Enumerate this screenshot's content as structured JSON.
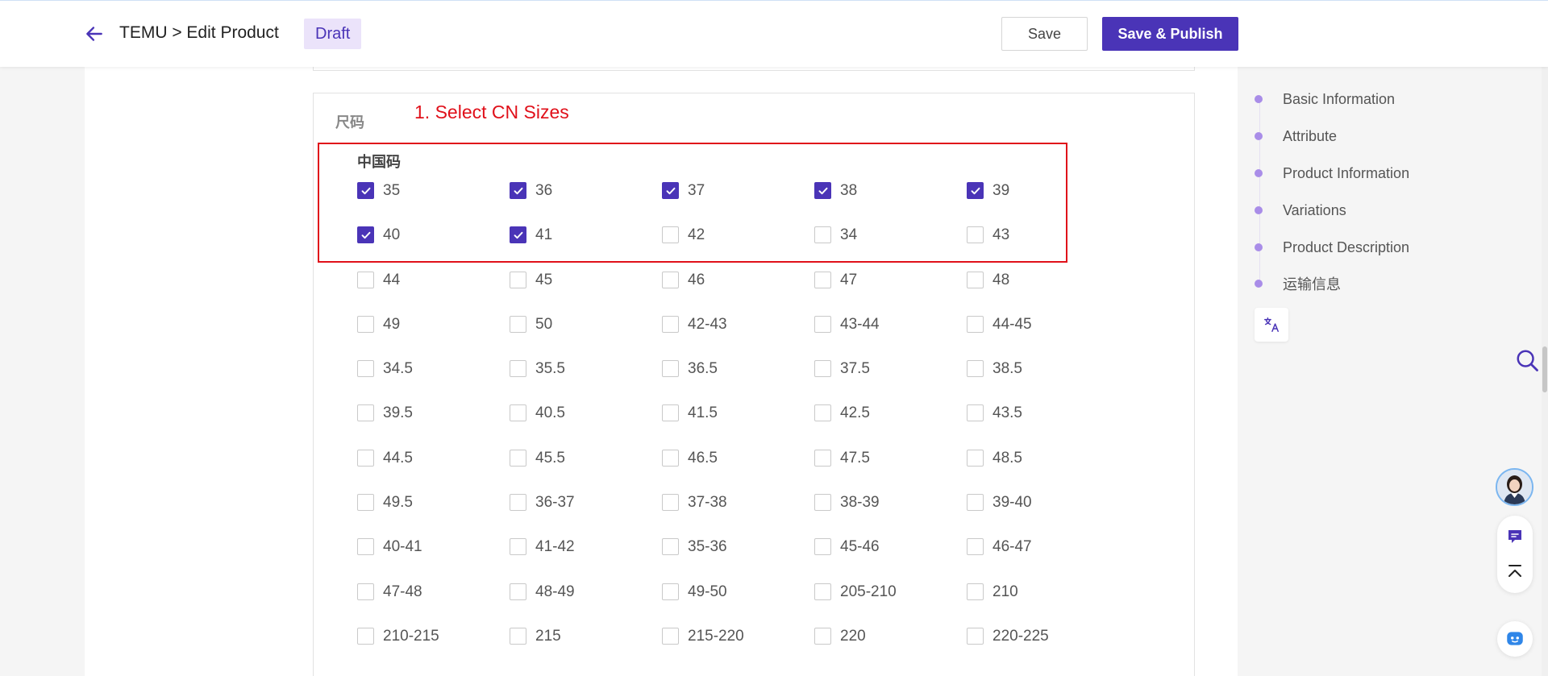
{
  "header": {
    "title": "TEMU > Edit Product",
    "status_badge": "Draft",
    "save_label": "Save",
    "publish_label": "Save & Publish"
  },
  "size_section": {
    "section_label": "尺码",
    "annotation": "1. Select CN Sizes",
    "group_label": "中国码",
    "options": [
      {
        "label": "35",
        "checked": true
      },
      {
        "label": "36",
        "checked": true
      },
      {
        "label": "37",
        "checked": true
      },
      {
        "label": "38",
        "checked": true
      },
      {
        "label": "39",
        "checked": true
      },
      {
        "label": "40",
        "checked": true
      },
      {
        "label": "41",
        "checked": true
      },
      {
        "label": "42",
        "checked": false
      },
      {
        "label": "34",
        "checked": false
      },
      {
        "label": "43",
        "checked": false
      },
      {
        "label": "44",
        "checked": false
      },
      {
        "label": "45",
        "checked": false
      },
      {
        "label": "46",
        "checked": false
      },
      {
        "label": "47",
        "checked": false
      },
      {
        "label": "48",
        "checked": false
      },
      {
        "label": "49",
        "checked": false
      },
      {
        "label": "50",
        "checked": false
      },
      {
        "label": "42-43",
        "checked": false
      },
      {
        "label": "43-44",
        "checked": false
      },
      {
        "label": "44-45",
        "checked": false
      },
      {
        "label": "34.5",
        "checked": false
      },
      {
        "label": "35.5",
        "checked": false
      },
      {
        "label": "36.5",
        "checked": false
      },
      {
        "label": "37.5",
        "checked": false
      },
      {
        "label": "38.5",
        "checked": false
      },
      {
        "label": "39.5",
        "checked": false
      },
      {
        "label": "40.5",
        "checked": false
      },
      {
        "label": "41.5",
        "checked": false
      },
      {
        "label": "42.5",
        "checked": false
      },
      {
        "label": "43.5",
        "checked": false
      },
      {
        "label": "44.5",
        "checked": false
      },
      {
        "label": "45.5",
        "checked": false
      },
      {
        "label": "46.5",
        "checked": false
      },
      {
        "label": "47.5",
        "checked": false
      },
      {
        "label": "48.5",
        "checked": false
      },
      {
        "label": "49.5",
        "checked": false
      },
      {
        "label": "36-37",
        "checked": false
      },
      {
        "label": "37-38",
        "checked": false
      },
      {
        "label": "38-39",
        "checked": false
      },
      {
        "label": "39-40",
        "checked": false
      },
      {
        "label": "40-41",
        "checked": false
      },
      {
        "label": "41-42",
        "checked": false
      },
      {
        "label": "35-36",
        "checked": false
      },
      {
        "label": "45-46",
        "checked": false
      },
      {
        "label": "46-47",
        "checked": false
      },
      {
        "label": "47-48",
        "checked": false
      },
      {
        "label": "48-49",
        "checked": false
      },
      {
        "label": "49-50",
        "checked": false
      },
      {
        "label": "205-210",
        "checked": false
      },
      {
        "label": "210",
        "checked": false
      },
      {
        "label": "210-215",
        "checked": false
      },
      {
        "label": "215",
        "checked": false
      },
      {
        "label": "215-220",
        "checked": false
      },
      {
        "label": "220",
        "checked": false
      },
      {
        "label": "220-225",
        "checked": false
      }
    ]
  },
  "right_nav": {
    "items": [
      {
        "label": "Basic Information"
      },
      {
        "label": "Attribute"
      },
      {
        "label": "Product Information"
      },
      {
        "label": "Variations"
      },
      {
        "label": "Product Description"
      },
      {
        "label": "运输信息"
      }
    ]
  },
  "colors": {
    "accent": "#4a34b7",
    "annotation_red": "#e0101a",
    "nav_dot": "#a98de8"
  },
  "icons": {
    "back": "arrow-left-icon",
    "translate": "translate-icon",
    "search": "search-icon",
    "support": "headset-icon",
    "back_to_top": "back-to-top-icon",
    "bot": "bot-icon"
  }
}
